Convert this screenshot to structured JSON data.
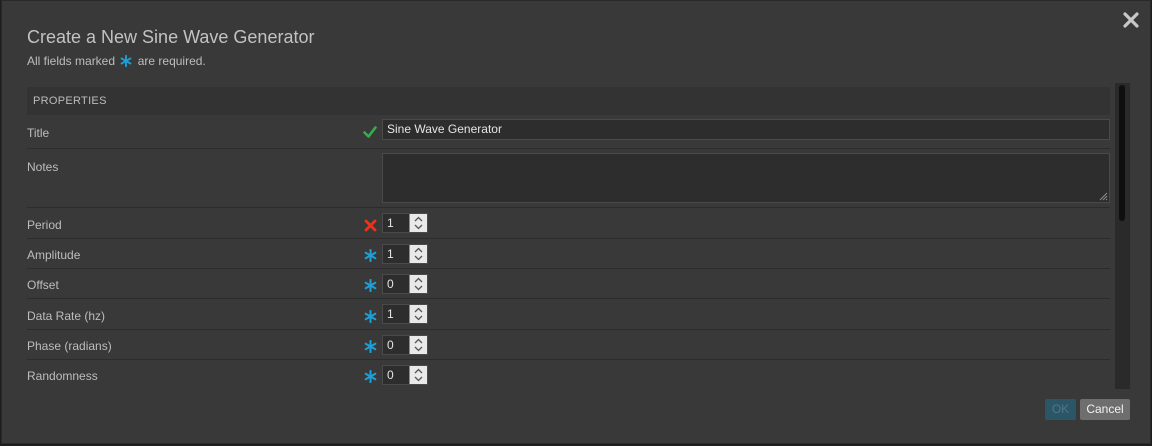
{
  "dialog": {
    "title": "Create a New Sine Wave Generator",
    "subtitle_before": "All fields marked",
    "subtitle_after": "are required."
  },
  "section": {
    "header": "PROPERTIES"
  },
  "fields": {
    "title": {
      "label": "Title",
      "value": "Sine Wave Generator",
      "status": "valid"
    },
    "notes": {
      "label": "Notes",
      "value": ""
    },
    "period": {
      "label": "Period",
      "value": "1",
      "status": "invalid"
    },
    "amplitude": {
      "label": "Amplitude",
      "value": "1",
      "status": "required"
    },
    "offset": {
      "label": "Offset",
      "value": "0",
      "status": "required"
    },
    "data_rate": {
      "label": "Data Rate (hz)",
      "value": "1",
      "status": "required"
    },
    "phase": {
      "label": "Phase (radians)",
      "value": "0",
      "status": "required"
    },
    "randomness": {
      "label": "Randomness",
      "value": "0",
      "status": "required"
    }
  },
  "buttons": {
    "ok": "OK",
    "cancel": "Cancel"
  },
  "icons": {
    "close": "close-icon",
    "valid": "checkmark-icon",
    "invalid": "x-mark-icon",
    "required": "asterisk-icon"
  },
  "colors": {
    "required": "#1e9fd6",
    "valid": "#33b04b",
    "invalid": "#e8341c",
    "ok_button": "#2b5667"
  }
}
